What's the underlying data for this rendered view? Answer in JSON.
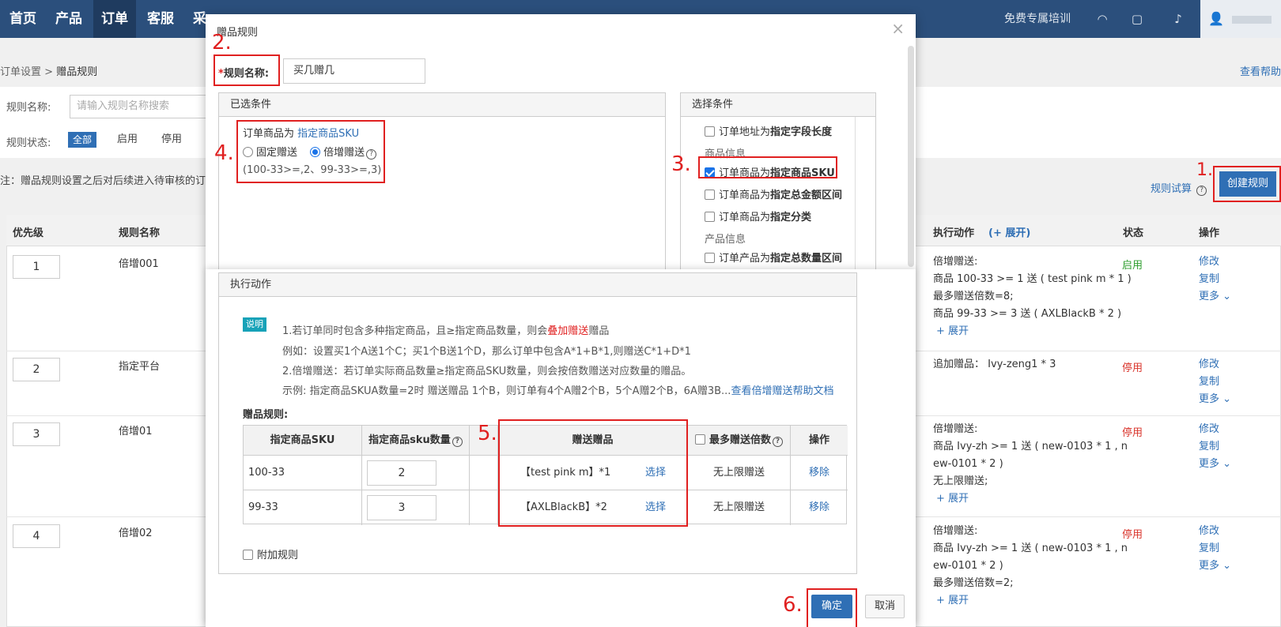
{
  "nav": {
    "items": [
      "首页",
      "产品",
      "订单",
      "客服",
      "采"
    ],
    "training": "免费专属培训"
  },
  "page": {
    "breadcrumb_parent": "订单设置",
    "breadcrumb_sep": ">",
    "breadcrumb_current": "赠品规则",
    "help_link": "查看帮助",
    "filter_name_label": "规则名称:",
    "filter_name_placeholder": "请输入规则名称搜索",
    "filter_status_label": "规则状态:",
    "status_tabs": [
      "全部",
      "启用",
      "停用"
    ],
    "note": "注：赠品规则设置之后对后续进入待审核的订单",
    "trial_link": "规则试算",
    "create_button": "创建规则",
    "table_headers": {
      "priority": "优先级",
      "rule_name": "规则名称",
      "action": "执行动作",
      "expand": "(+ 展开)",
      "status": "状态",
      "ops": "操作"
    },
    "rows": [
      {
        "priority": "1",
        "name": "倍增001",
        "action_lines": [
          "倍增赠送:",
          "商品 100-33 >= 1 送 ( test pink m * 1 )",
          "最多赠送倍数=8;",
          "商品 99-33 >= 3 送 ( AXLBlackB * 2 )",
          "+ 展开"
        ],
        "status": "启用",
        "ops": [
          "修改",
          "复制",
          "更多 ⌄"
        ]
      },
      {
        "priority": "2",
        "name": "指定平台",
        "action_lines": [
          "追加赠品： Ivy-zeng1 * 3"
        ],
        "status": "停用",
        "ops": [
          "修改",
          "复制",
          "更多 ⌄"
        ]
      },
      {
        "priority": "3",
        "name": "倍增01",
        "action_lines": [
          "倍增赠送:",
          "商品 Ivy-zh >= 1 送 ( new-0103 * 1 , n",
          "ew-0101 * 2 )",
          "无上限赠送;",
          "+ 展开"
        ],
        "status": "停用",
        "ops": [
          "修改",
          "复制",
          "更多 ⌄"
        ]
      },
      {
        "priority": "4",
        "name": "倍增02",
        "action_lines": [
          "倍增赠送:",
          "商品 Ivy-zh >= 1 送 ( new-0103 * 1 , n",
          "ew-0101 * 2 )",
          "最多赠送倍数=2;",
          "+ 展开"
        ],
        "status": "停用",
        "ops": [
          "修改",
          "复制",
          "更多 ⌄"
        ]
      }
    ]
  },
  "dialog": {
    "title": "赠品规则",
    "close": "×",
    "rule_name_required": "*",
    "rule_name_label": "规则名称:",
    "rule_name_value": "买几赠几",
    "selected_panel_title": "已选条件",
    "selected_condition_prefix": "订单商品为",
    "selected_condition_link": "指定商品SKU",
    "radio_fixed": "固定赠送",
    "radio_multiply": "倍增赠送",
    "selected_formula": "(100-33>=,2、99-33>=,3)",
    "choose_panel_title": "选择条件",
    "conditions": [
      {
        "prefix": "订单地址为",
        "bold": "指定字段长度",
        "checked": false
      },
      {
        "group": "商品信息"
      },
      {
        "prefix": "订单商品为",
        "bold": "指定商品SKU",
        "checked": true
      },
      {
        "prefix": "订单商品为",
        "bold": "指定总金额区间",
        "checked": false
      },
      {
        "prefix": "订单商品为",
        "bold": "指定分类",
        "checked": false
      },
      {
        "group": "产品信息"
      },
      {
        "prefix": "订单产品为",
        "bold": "指定总数量区间",
        "checked": false
      }
    ],
    "action_panel_title": "执行动作",
    "desc_tag": "说明",
    "desc_line1_a": "1.若订单同时包含多种指定商品，且≥指定商品数量，则会",
    "desc_line1_hl": "叠加赠送",
    "desc_line1_b": "赠品",
    "desc_line2": "例如：设置买1个A送1个C；买1个B送1个D，那么订单中包含A*1+B*1,则赠送C*1+D*1",
    "desc_line3": "2.倍增赠送：若订单实际商品数量≥指定商品SKU数量，则会按倍数赠送对应数量的赠品。",
    "desc_line4_a": "示例: 指定商品SKUA数量=2时 赠送赠品 1个B，则订单有4个A赠2个B，5个A赠2个B，6A赠3B...",
    "desc_line4_link": "查看倍增赠送帮助文档",
    "gift_rules_label": "赠品规则:",
    "gift_table_headers": {
      "sku": "指定商品SKU",
      "qty": "指定商品sku数量",
      "gift": "赠送赠品",
      "max": "最多赠送倍数",
      "op": "操作"
    },
    "gift_rows": [
      {
        "sku": "100-33",
        "qty": "2",
        "gift": "【test pink m】*1",
        "select": "选择",
        "max": "无上限赠送",
        "remove": "移除"
      },
      {
        "sku": "99-33",
        "qty": "3",
        "gift": "【AXLBlackB】*2",
        "select": "选择",
        "max": "无上限赠送",
        "remove": "移除"
      }
    ],
    "extra_rule": "附加规则",
    "ok": "确定",
    "cancel": "取消"
  },
  "annotations": [
    "1.",
    "2.",
    "3.",
    "4.",
    "5.",
    "6."
  ]
}
